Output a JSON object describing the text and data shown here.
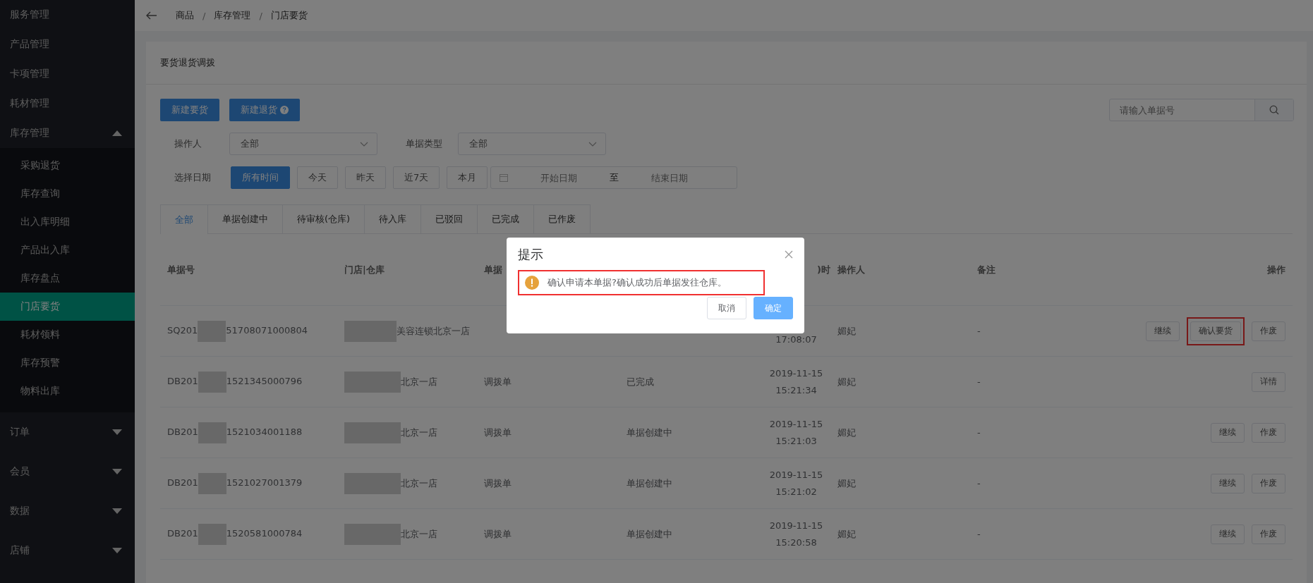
{
  "sidebar": {
    "items": [
      {
        "label": "服务管理",
        "has_caret": false
      },
      {
        "label": "产品管理",
        "has_caret": false
      },
      {
        "label": "卡项管理",
        "has_caret": false
      },
      {
        "label": "耗材管理",
        "has_caret": false
      },
      {
        "label": "库存管理",
        "expanded": true,
        "has_caret": true,
        "children": [
          {
            "label": "采购退货",
            "selected": false
          },
          {
            "label": "库存查询",
            "selected": false
          },
          {
            "label": "出入库明细",
            "selected": false
          },
          {
            "label": "产品出入库",
            "selected": false
          },
          {
            "label": "库存盘点",
            "selected": false
          },
          {
            "label": "门店要货",
            "selected": true
          },
          {
            "label": "耗材领料",
            "selected": false
          },
          {
            "label": "库存预警",
            "selected": false
          },
          {
            "label": "物料出库",
            "selected": false
          }
        ]
      },
      {
        "label": "订单",
        "expanded": false,
        "has_caret": true
      },
      {
        "label": "会员",
        "expanded": false,
        "has_caret": true
      },
      {
        "label": "数据",
        "expanded": false,
        "has_caret": true
      },
      {
        "label": "店铺",
        "expanded": false,
        "has_caret": true
      }
    ]
  },
  "breadcrumb": [
    "商品",
    "库存管理",
    "门店要货"
  ],
  "breadcrumb_separator": "/",
  "card_title": "要货退货调拨",
  "action_buttons": [
    {
      "label": "新建要货",
      "help": false
    },
    {
      "label": "新建退货",
      "help": true
    }
  ],
  "search": {
    "placeholder": "请输入单据号"
  },
  "filters": [
    {
      "label": "操作人",
      "value": "全部"
    },
    {
      "label": "单据类型",
      "value": "全部"
    }
  ],
  "date_filter": {
    "label": "选择日期",
    "options": [
      {
        "label": "所有时间",
        "selected": true
      },
      {
        "label": "今天",
        "selected": false
      },
      {
        "label": "昨天",
        "selected": false
      },
      {
        "label": "近7天",
        "selected": false
      },
      {
        "label": "本月",
        "selected": false
      }
    ],
    "start_placeholder": "开始日期",
    "separator": "至",
    "end_placeholder": "结束日期"
  },
  "tabs": [
    {
      "label": "全部",
      "selected": true
    },
    {
      "label": "单据创建中",
      "selected": false
    },
    {
      "label": "待审核(仓库)",
      "selected": false
    },
    {
      "label": "待入库",
      "selected": false
    },
    {
      "label": "已驳回",
      "selected": false
    },
    {
      "label": "已完成",
      "selected": false
    },
    {
      "label": "已作废",
      "selected": false
    }
  ],
  "table": {
    "columns": [
      "单据号",
      "门店|仓库",
      "单据",
      "",
      ")时",
      "操作人",
      "备注",
      "操作"
    ],
    "rows": [
      {
        "id_start": "SQ201",
        "id_end": "51708071000804",
        "store": "美容连锁北京一店",
        "time": "17:08:07",
        "operator": "媚妃",
        "note": "-",
        "actions": [
          {
            "label": "继续",
            "highlighted": false
          },
          {
            "label": "确认要货",
            "highlighted": true
          },
          {
            "label": "作废",
            "highlighted": false
          }
        ]
      },
      {
        "id_start": "DB201",
        "id_end": "1521345000796",
        "store": "北京一店",
        "type": "调拨单",
        "status": "已完成",
        "date": "2019-11-15",
        "time": "15:21:34",
        "operator": "媚妃",
        "note": "-",
        "actions": [
          {
            "label": "详情",
            "highlighted": false
          }
        ]
      },
      {
        "id_start": "DB201",
        "id_end": "1521034001188",
        "store": "北京一店",
        "type": "调拨单",
        "status": "单据创建中",
        "date": "2019-11-15",
        "time": "15:21:03",
        "operator": "媚妃",
        "note": "-",
        "actions": [
          {
            "label": "继续",
            "highlighted": false
          },
          {
            "label": "作废",
            "highlighted": false
          }
        ]
      },
      {
        "id_start": "DB201",
        "id_end": "1521027001379",
        "store": "北京一店",
        "type": "调拨单",
        "status": "单据创建中",
        "date": "2019-11-15",
        "time": "15:21:02",
        "operator": "媚妃",
        "note": "-",
        "actions": [
          {
            "label": "继续",
            "highlighted": false
          },
          {
            "label": "作废",
            "highlighted": false
          }
        ]
      },
      {
        "id_start": "DB201",
        "id_end": "1520581000784",
        "store": "北京一店",
        "type": "调拨单",
        "status": "单据创建中",
        "date": "2019-11-15",
        "time": "15:20:58",
        "operator": "媚妃",
        "note": "-",
        "actions": [
          {
            "label": "继续",
            "highlighted": false
          },
          {
            "label": "作废",
            "highlighted": false
          }
        ]
      }
    ]
  },
  "dialog": {
    "title": "提示",
    "message": "确认申请本单据?确认成功后单据发往仓库。",
    "highlighted": true,
    "buttons": [
      {
        "label": "取消",
        "kind": "default"
      },
      {
        "label": "确定",
        "kind": "primary"
      }
    ]
  }
}
